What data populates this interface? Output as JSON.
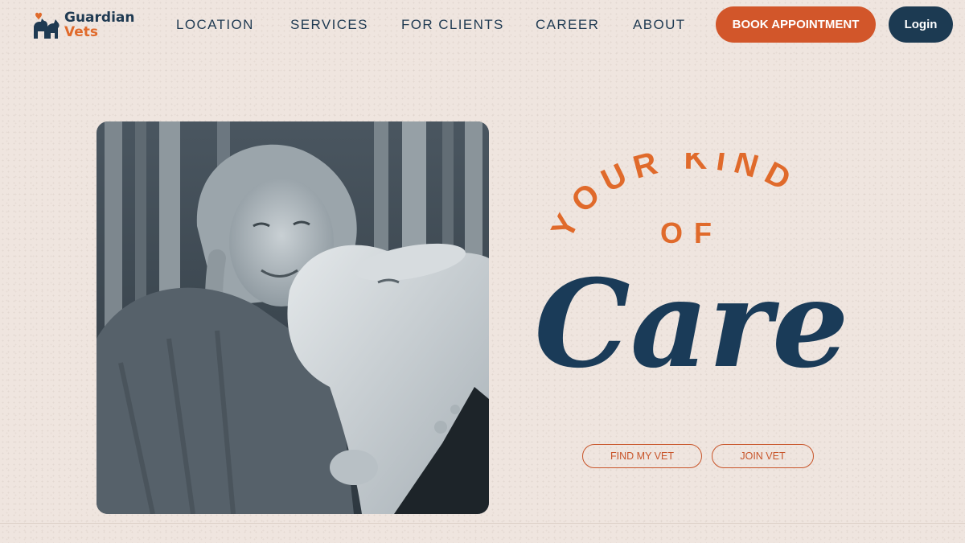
{
  "brand": {
    "line1": "Guardian",
    "line2": "Vets",
    "primary_color": "#1f3a52",
    "accent_color": "#e06a2b"
  },
  "nav": {
    "items": [
      {
        "label": "LOCATION"
      },
      {
        "label": "SERVICES"
      },
      {
        "label": "FOR CLIENTS"
      },
      {
        "label": "CAREER"
      },
      {
        "label": "ABOUT"
      }
    ]
  },
  "header": {
    "book_label": "BOOK APPOINTMENT",
    "login_label": "Login",
    "book_color": "#d2562a",
    "login_color": "#1c3a52"
  },
  "hero": {
    "image_icon": "girl-hugging-goat-photo",
    "headline_arc_1": "YOUR KIND",
    "headline_arc_2": "OF",
    "headline_script": "Care",
    "find_vet_label": "FIND MY VET",
    "join_vet_label": "JOIN VET"
  },
  "background_color": "#efe5df"
}
